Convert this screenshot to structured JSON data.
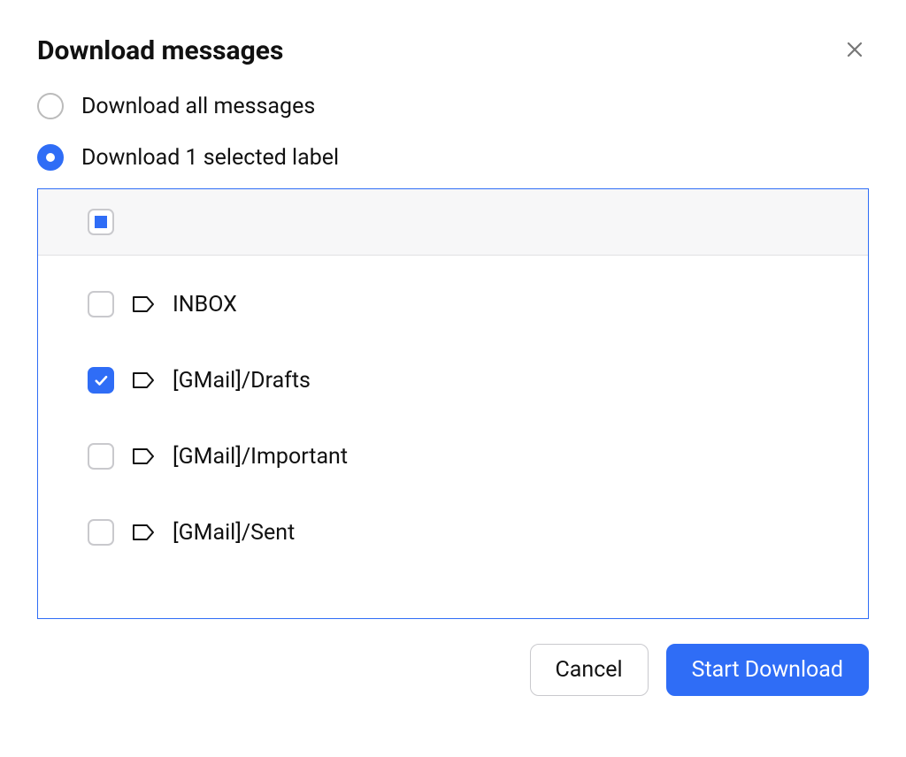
{
  "dialog": {
    "title": "Download messages",
    "options": {
      "all": "Download all messages",
      "selected": "Download 1 selected label"
    },
    "selected_option": "selected",
    "labels": [
      {
        "name": "INBOX",
        "checked": false
      },
      {
        "name": "[GMail]/Drafts",
        "checked": true
      },
      {
        "name": "[GMail]/Important",
        "checked": false
      },
      {
        "name": "[GMail]/Sent",
        "checked": false
      }
    ],
    "select_all_state": "indeterminate",
    "buttons": {
      "cancel": "Cancel",
      "start": "Start Download"
    }
  }
}
